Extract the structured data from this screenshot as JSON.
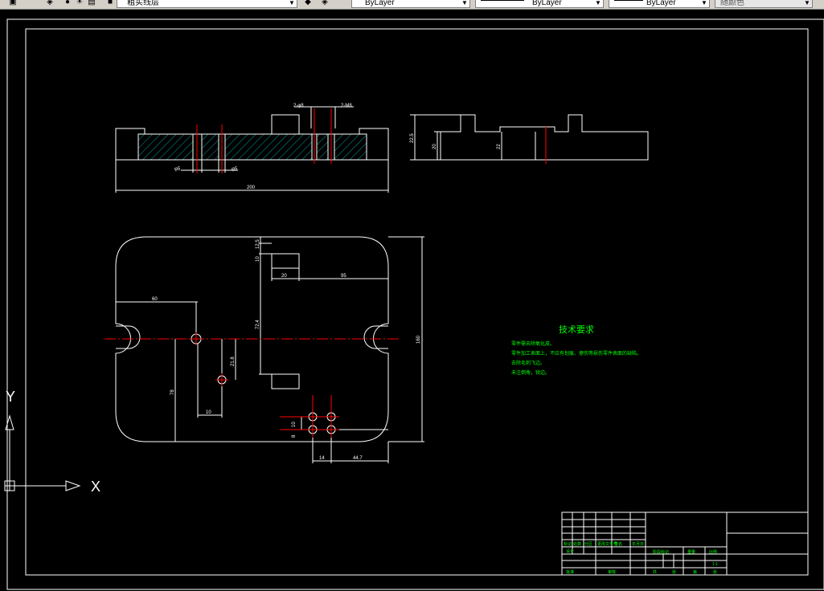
{
  "toolbar": {
    "layer_name": "粗实线层",
    "color_combo": "ByLayer",
    "linetype_combo": "ByLayer",
    "lineweight_combo": "ByLayer",
    "plotstyle_combo": "随颜色"
  },
  "drawing": {
    "front_dims": {
      "hole_left": "2-φ8",
      "hole_right": "2-M8",
      "w_left": "φ5",
      "w_right": "φ5",
      "total": "200"
    },
    "side_dims": {
      "h_total": "22.5",
      "h_a": "20",
      "h_b": "22"
    },
    "plan_dims": {
      "d_top_a": "12.5",
      "d_top_b": "10",
      "d_slot_w": "20",
      "d_slot_x": "95",
      "d_left": "60",
      "d_mid": "72.4",
      "d_hole_y": "21.8",
      "d_bottom_y": "78",
      "d_bottom_x": "10",
      "d_height": "160",
      "d_grid_y1": "10",
      "d_grid_y2": "8",
      "d_grid_x": "14",
      "d_grid_r": "44.7"
    },
    "tech": {
      "title": "技术要求",
      "lines": [
        "零件需去除氧化皮。",
        "零件加工表面上，不应有划痕、擦伤等损伤零件表面的缺陷。",
        "去除毛刺飞边。",
        "未注倒角，锐边。"
      ]
    },
    "title_block": {
      "row_labels": [
        "标记",
        "处数",
        "分区",
        "更改文件号",
        "签名",
        "年月日"
      ],
      "design_label": "设计",
      "stage_label": "阶段标记",
      "weight_label": "重量",
      "scale_label": "比例",
      "scale_value": "1:1",
      "review_label": "审核",
      "approve_label": "批准",
      "sheet_labels": [
        "共",
        "张",
        "第",
        "张"
      ]
    },
    "ucs": {
      "x": "X",
      "y": "Y"
    }
  },
  "colors": {
    "background": "#000000",
    "linework": "#ffffff",
    "center": "#ff0000",
    "hatch": "#00c8c8",
    "text": "#00ff00"
  }
}
